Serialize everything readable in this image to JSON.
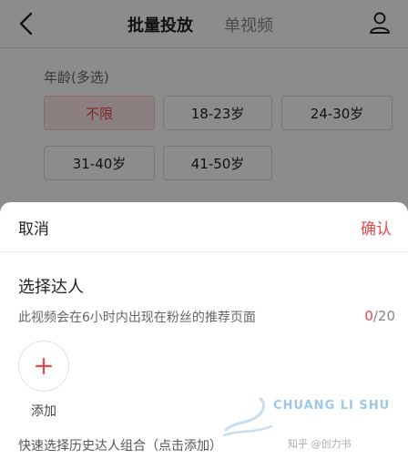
{
  "header": {
    "tabs": [
      {
        "label": "批量投放",
        "active": true
      },
      {
        "label": "单视频",
        "active": false
      }
    ]
  },
  "filters": {
    "age_label": "年龄(多选)",
    "age_options": [
      {
        "label": "不限",
        "selected": true
      },
      {
        "label": "18-23岁",
        "selected": false
      },
      {
        "label": "24-30岁",
        "selected": false
      },
      {
        "label": "31-40岁",
        "selected": false
      },
      {
        "label": "41-50岁",
        "selected": false
      }
    ]
  },
  "sheet": {
    "cancel_label": "取消",
    "confirm_label": "确认",
    "title": "选择达人",
    "description": "此视频会在6小时内出现在粉丝的推荐页面",
    "count_current": "0",
    "count_total": "/20",
    "add_label": "添加",
    "quick_select": "快速选择历史达人组合（点击添加）"
  },
  "watermark": {
    "brand": "CHUANG LI SHU",
    "source": "知乎 @创力书"
  },
  "colors": {
    "accent": "#e8484d",
    "selected_bg": "#fde7ea"
  }
}
